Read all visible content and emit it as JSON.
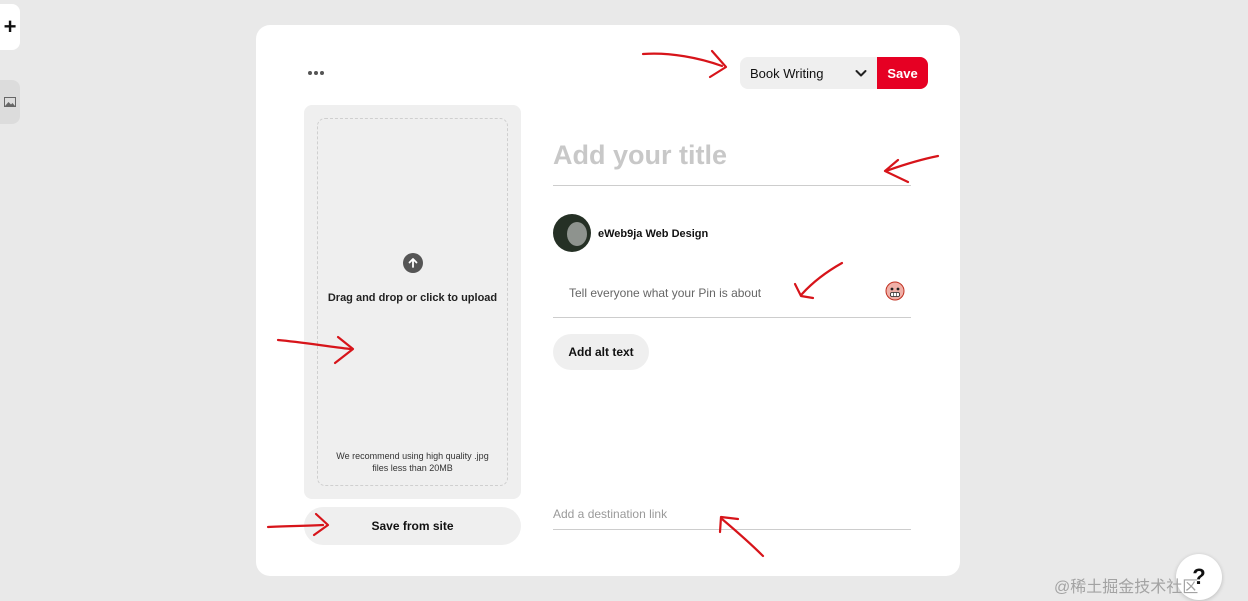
{
  "rail": {
    "add_label": "+"
  },
  "toolbar": {
    "board_value": "Book Writing",
    "save_label": "Save"
  },
  "upload": {
    "prompt": "Drag and drop or click to upload",
    "hint": "We recommend using high quality .jpg files less than 20MB",
    "save_from_site_label": "Save from site"
  },
  "form": {
    "title_placeholder": "Add your title",
    "author_name": "eWeb9ja Web Design",
    "description_placeholder": "Tell everyone what your Pin is about",
    "alt_text_label": "Add alt text",
    "link_placeholder": "Add a destination link"
  },
  "help": {
    "label": "?"
  },
  "watermark": "@稀土掘金技术社区",
  "colors": {
    "accent": "#e60023",
    "annotation": "#d7141a"
  }
}
